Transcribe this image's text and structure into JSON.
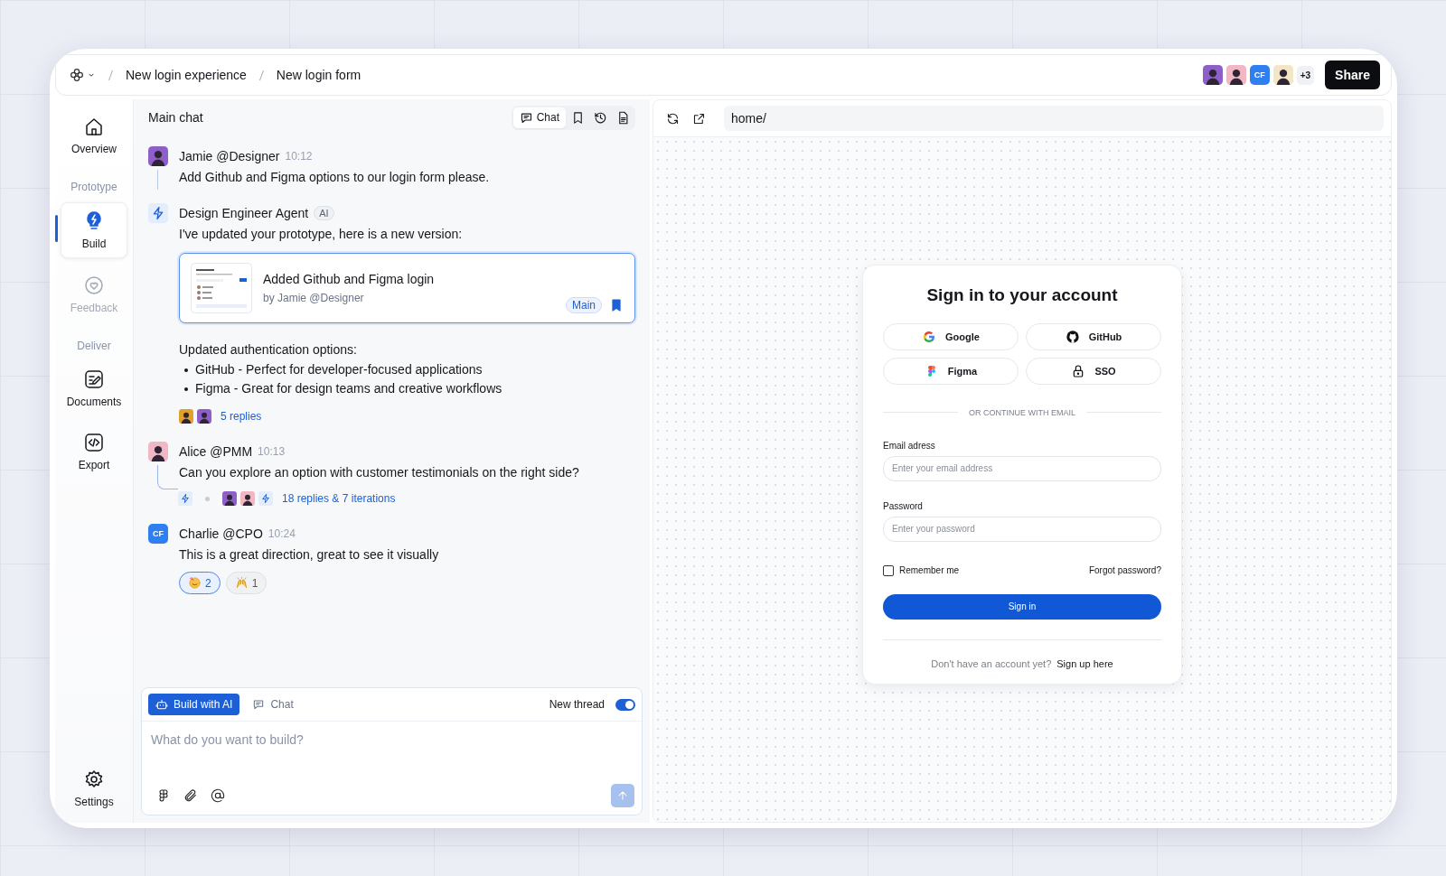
{
  "topbar": {
    "breadcrumb": [
      "New login experience",
      "New login form"
    ],
    "collaborators": [
      {
        "kind": "photo",
        "color": "#8e5fc9"
      },
      {
        "kind": "photo",
        "color": "#f3b6c4"
      },
      {
        "kind": "initials",
        "text": "CF"
      },
      {
        "kind": "photo",
        "color": "#f3e6c6"
      }
    ],
    "more": "+3",
    "share": "Share"
  },
  "sidebar": {
    "groups": [
      {
        "items": [
          {
            "label": "Overview",
            "selected": false,
            "disabled": false
          }
        ]
      },
      {
        "heading": "Prototype",
        "items": [
          {
            "label": "Build",
            "selected": true,
            "disabled": false
          },
          {
            "label": "Feedback",
            "selected": false,
            "disabled": true
          }
        ]
      },
      {
        "heading": "Deliver",
        "items": [
          {
            "label": "Documents",
            "selected": false,
            "disabled": false
          },
          {
            "label": "Export",
            "selected": false,
            "disabled": false
          }
        ]
      }
    ],
    "settings": "Settings"
  },
  "chat": {
    "title": "Main chat",
    "tabs": [
      {
        "label": "Chat",
        "selected": true
      },
      {
        "selected": false
      },
      {
        "selected": false
      },
      {
        "selected": false
      }
    ],
    "messages": [
      {
        "author": "Jamie @Designer",
        "time": "10:12",
        "avatar": {
          "kind": "photo",
          "color": "#8e5fc9"
        },
        "text": "Add Github and Figma options to our login form please."
      },
      {
        "author": "Design Engineer Agent",
        "badge": "AI",
        "avatar": {
          "kind": "agent"
        },
        "text": "I've updated your prototype, here is a new version:",
        "version_card": {
          "title": "Added Github and Figma login",
          "byline": "by Jamie @Designer",
          "branch": "Main",
          "bookmarked": true
        },
        "summary": "Updated authentication options:",
        "bullets": [
          "GitHub - Perfect for developer-focused applications",
          "Figma - Great for design teams and creative workflows"
        ],
        "replies": {
          "avatars": [
            {
              "kind": "photo",
              "color": "#e0a02a"
            },
            {
              "kind": "photo",
              "color": "#8e5fc9"
            }
          ],
          "text": "5 replies"
        }
      },
      {
        "author": "Alice @PMM",
        "time": "10:13",
        "avatar": {
          "kind": "photo",
          "color": "#f3b6c4"
        },
        "text": "Can you explore an option with customer testimonials on the right side?",
        "thread": {
          "lead": {
            "kind": "agent"
          },
          "avatars": [
            {
              "kind": "photo",
              "color": "#8e5fc9"
            },
            {
              "kind": "photo",
              "color": "#f3b6c4"
            },
            {
              "kind": "agent"
            }
          ],
          "text": "18 replies & 7 iterations"
        }
      },
      {
        "author": "Charlie @CPO",
        "time": "10:24",
        "avatar": {
          "kind": "initials",
          "text": "CF"
        },
        "text": "This is a great direction, great to see it visually",
        "reactions": [
          {
            "count": "2",
            "selected": true
          },
          {
            "count": "1",
            "selected": false
          }
        ]
      }
    ],
    "composer": {
      "modes": [
        {
          "label": "Build with AI",
          "selected": true
        },
        {
          "label": "Chat",
          "selected": false
        }
      ],
      "new_thread": {
        "label": "New thread",
        "on": true
      },
      "placeholder": "What do you want to build?"
    }
  },
  "preview": {
    "url": "home/",
    "login": {
      "title": "Sign in to your account",
      "providers": [
        {
          "label": "Google"
        },
        {
          "label": "GitHub"
        },
        {
          "label": "Figma"
        },
        {
          "label": "SSO"
        }
      ],
      "divider": "OR CONTINUE WITH EMAIL",
      "fields": [
        {
          "label": "Email adress",
          "placeholder": "Enter your email address"
        },
        {
          "label": "Password",
          "placeholder": "Enter your password"
        }
      ],
      "remember": {
        "label": "Remember me",
        "checked": false
      },
      "forgot": "Forgot password?",
      "submit": "Sign in",
      "footer": {
        "prompt": "Don't have an account yet?",
        "link": "Sign up here"
      }
    }
  }
}
